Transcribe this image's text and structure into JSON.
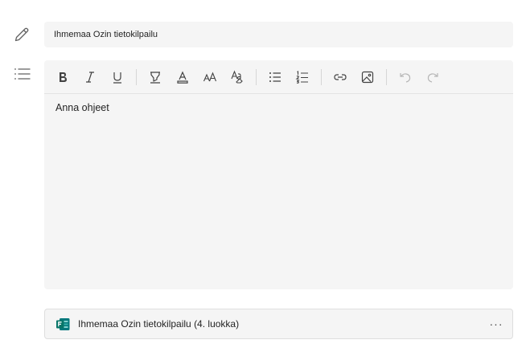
{
  "assignment": {
    "title": "Ihmemaa Ozin tietokilpailu"
  },
  "instructions": {
    "placeholder": "Anna ohjeet"
  },
  "toolbar": {
    "buttons": [
      {
        "icon": "bold-icon"
      },
      {
        "icon": "italic-icon"
      },
      {
        "icon": "underline-icon"
      },
      {
        "icon": "highlight-icon"
      },
      {
        "icon": "font-color-icon"
      },
      {
        "icon": "font-size-icon"
      },
      {
        "icon": "clear-formatting-icon"
      },
      {
        "icon": "bulleted-list-icon"
      },
      {
        "icon": "numbered-list-icon"
      },
      {
        "icon": "link-icon"
      },
      {
        "icon": "image-icon"
      },
      {
        "icon": "undo-icon"
      },
      {
        "icon": "redo-icon"
      }
    ]
  },
  "attachment": {
    "label": "Ihmemaa Ozin tietokilpailu (4. luokka)",
    "more": "···",
    "icon": "microsoft-forms-icon",
    "icon_color": "#077568"
  }
}
